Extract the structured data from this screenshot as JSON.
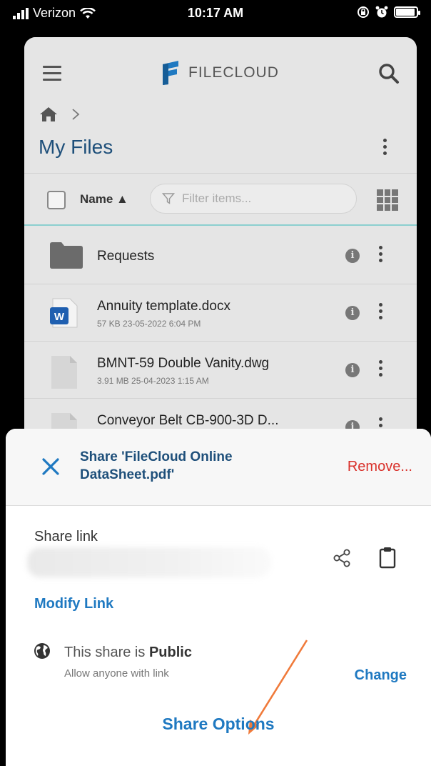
{
  "status_bar": {
    "carrier": "Verizon",
    "time": "10:17 AM",
    "battery_level": 0.92
  },
  "header": {
    "app_name": "FILECLOUD",
    "page_title": "My Files"
  },
  "toolbar": {
    "sort_label": "Name ▲",
    "filter_placeholder": "Filter items..."
  },
  "files": [
    {
      "name": "Requests",
      "meta": "",
      "type": "folder"
    },
    {
      "name": "Annuity template.docx",
      "meta": "57 KB 23-05-2022 6:04 PM",
      "type": "word"
    },
    {
      "name": "BMNT-59 Double Vanity.dwg",
      "meta": "3.91 MB 25-04-2023 1:15 AM",
      "type": "file"
    },
    {
      "name": "Conveyor Belt CB-900-3D D...",
      "meta": "",
      "type": "file"
    }
  ],
  "share_sheet": {
    "title": "Share 'FileCloud Online DataSheet.pdf'",
    "remove_label": "Remove...",
    "share_link_label": "Share link",
    "modify_link_label": "Modify Link",
    "public_prefix": "This share is ",
    "public_value": "Public",
    "allow_text": "Allow anyone with link",
    "change_label": "Change",
    "share_options_label": "Share Options"
  },
  "colors": {
    "accent_blue": "#1f79c1",
    "title_blue": "#1e4f7a",
    "danger_red": "#d9312b",
    "annotation_arrow": "#f07a3a"
  }
}
